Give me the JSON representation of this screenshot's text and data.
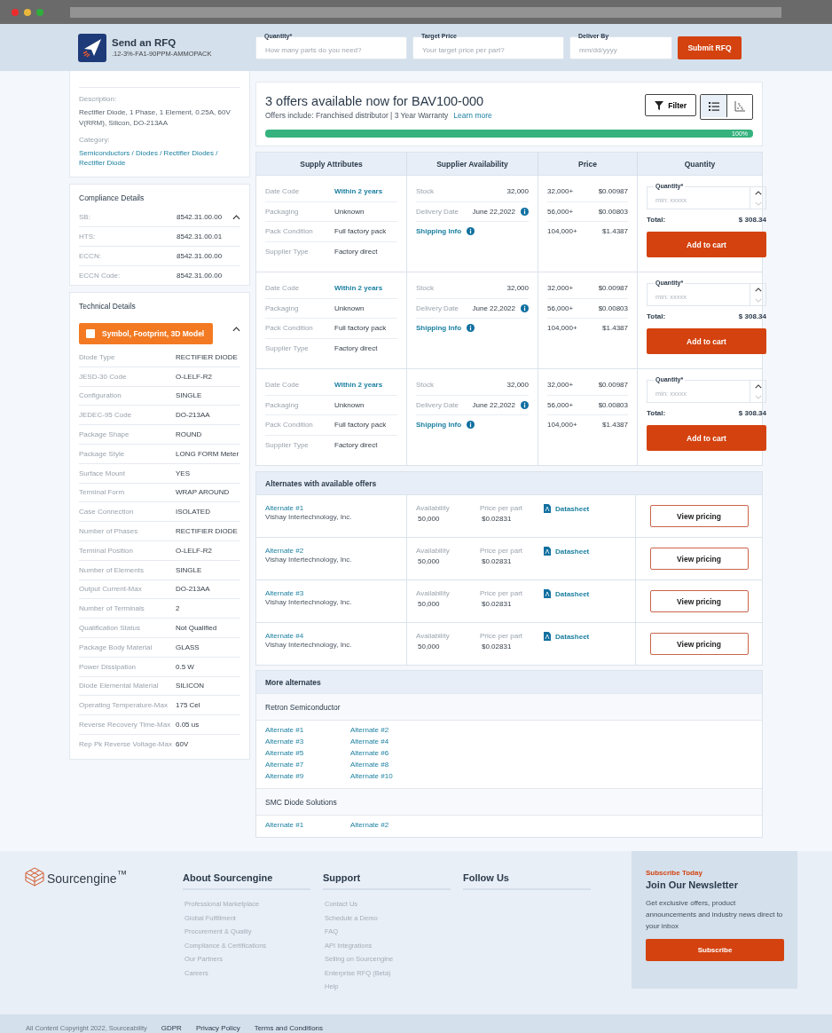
{
  "header": {
    "title": "Send an RFQ",
    "part": ".12-3%-FA1-90PPM-AMMOPACK",
    "fields": [
      {
        "label": "Quantity*",
        "placeholder": "How many parts do you need?"
      },
      {
        "label": "Target Price",
        "placeholder": "Your target price per part?"
      },
      {
        "label": "Deliver By",
        "placeholder": "mm/dd/yyyy"
      }
    ],
    "submit": "Submit RFQ"
  },
  "sidebar": {
    "description_label": "Description:",
    "description": "Rectifier Diode, 1 Phase, 1 Element, 0.25A, 60V V(RRM), Silicon, DO-213AA",
    "category_label": "Category:",
    "category": "Semiconductors / Diodes / Rectifier Diodes / Rectifier Diode",
    "compliance": {
      "title": "Compliance Details",
      "expanded": true,
      "rows": [
        {
          "label": "SB:",
          "value": "8542.31.00.00"
        },
        {
          "label": "HTS:",
          "value": "8542.31.00.01"
        },
        {
          "label": "ECCN:",
          "value": "8542.31.00.00"
        },
        {
          "label": "ECCN Code:",
          "value": "8542.31.00.00"
        }
      ]
    },
    "technical": {
      "title": "Technical Details",
      "expanded": true,
      "model_button": "Symbol, Footprint, 3D Model",
      "rows": [
        {
          "label": "Diode Type",
          "value": "RECTIFIER DIODE"
        },
        {
          "label": "JESD-30 Code",
          "value": "O-LELF-R2"
        },
        {
          "label": "Configuration",
          "value": "SINGLE"
        },
        {
          "label": "JEDEC-95 Code",
          "value": "DO-213AA"
        },
        {
          "label": "Package Shape",
          "value": "ROUND"
        },
        {
          "label": "Package Style",
          "value": "LONG FORM Meter"
        },
        {
          "label": "Surface Mount",
          "value": "YES"
        },
        {
          "label": "Terminal Form",
          "value": "WRAP AROUND"
        },
        {
          "label": "Case Connection",
          "value": "ISOLATED"
        },
        {
          "label": "Number of Phases",
          "value": "RECTIFIER DIODE"
        },
        {
          "label": "Terminal Position",
          "value": "O-LELF-R2"
        },
        {
          "label": "Number of Elements",
          "value": "SINGLE"
        },
        {
          "label": "Output Current-Max",
          "value": "DO-213AA"
        },
        {
          "label": "Number of Terminals",
          "value": "2"
        },
        {
          "label": "Qualification Status",
          "value": "Not Qualified"
        },
        {
          "label": "Package Body Material",
          "value": "GLASS"
        },
        {
          "label": "Power Dissipation",
          "value": "0.5 W"
        },
        {
          "label": "Diode Elemental Material",
          "value": "SILICON"
        },
        {
          "label": "Operating Temperature-Max",
          "value": "175 Cel"
        },
        {
          "label": "Reverse Recovery Time-Max",
          "value": "0.05 us"
        },
        {
          "label": "Rep Pk Reverse Voltage-Max",
          "value": "60V"
        }
      ]
    }
  },
  "offers": {
    "title": "3 offers available now for BAV100-000",
    "subtitle": "Offers include: Franchised distributor | 3 Year Warranty",
    "learn_more": "Learn more",
    "filter": "Filter",
    "views": [
      {
        "kind": "list",
        "selected": true
      },
      {
        "kind": "scatter",
        "selected": false
      }
    ],
    "progress": {
      "level": 1,
      "label": "100%"
    },
    "columns": [
      "Supply Attributes",
      "Supplier Availability",
      "Price",
      "Quantity"
    ],
    "rows": [
      {
        "attributes": [
          {
            "label": "Date Code",
            "value": "Within 2 years",
            "kind": "highlight"
          },
          {
            "label": "Packaging",
            "value": "Unknown",
            "kind": "plain"
          },
          {
            "label": "Pack Condition",
            "value": "Full factory pack",
            "kind": "plain"
          },
          {
            "label": "Supplier Type",
            "value": "Factory direct",
            "kind": "plain"
          }
        ],
        "stock_label": "Stock",
        "stock": "32,000",
        "delivery_label": "Delivery Date",
        "delivery": "June 22,2022",
        "shipping": "Shipping Info",
        "prices": [
          {
            "qty": "32,000+",
            "price": "$0.00987"
          },
          {
            "qty": "56,000+",
            "price": "$0.00803"
          },
          {
            "qty": "104,000+",
            "price": "$1.4387"
          }
        ],
        "quantity_label": "Quantity*",
        "quantity_placeholder": "min: xxxxx",
        "total_label": "Total:",
        "total": "$ 308.34",
        "button": "Add to cart"
      },
      {
        "attributes": [
          {
            "label": "Date Code",
            "value": "Within 2 years",
            "kind": "highlight"
          },
          {
            "label": "Packaging",
            "value": "Unknown",
            "kind": "plain"
          },
          {
            "label": "Pack Condition",
            "value": "Full factory pack",
            "kind": "plain"
          },
          {
            "label": "Supplier Type",
            "value": "Factory direct",
            "kind": "plain"
          }
        ],
        "stock_label": "Stock",
        "stock": "32,000",
        "delivery_label": "Delivery Date",
        "delivery": "June 22,2022",
        "shipping": "Shipping Info",
        "prices": [
          {
            "qty": "32,000+",
            "price": "$0.00987"
          },
          {
            "qty": "56,000+",
            "price": "$0.00803"
          },
          {
            "qty": "104,000+",
            "price": "$1.4387"
          }
        ],
        "quantity_label": "Quantity*",
        "quantity_placeholder": "min: xxxxx",
        "total_label": "Total:",
        "total": "$ 308.34",
        "button": "Add to cart"
      },
      {
        "attributes": [
          {
            "label": "Date Code",
            "value": "Within 2 years",
            "kind": "highlight"
          },
          {
            "label": "Packaging",
            "value": "Unknown",
            "kind": "plain"
          },
          {
            "label": "Pack Condition",
            "value": "Full factory pack",
            "kind": "plain"
          },
          {
            "label": "Supplier Type",
            "value": "Factory direct",
            "kind": "plain"
          }
        ],
        "stock_label": "Stock",
        "stock": "32,000",
        "delivery_label": "Delivery Date",
        "delivery": "June 22,2022",
        "shipping": "Shipping Info",
        "prices": [
          {
            "qty": "32,000+",
            "price": "$0.00987"
          },
          {
            "qty": "56,000+",
            "price": "$0.00803"
          },
          {
            "qty": "104,000+",
            "price": "$1.4387"
          }
        ],
        "quantity_label": "Quantity*",
        "quantity_placeholder": "min: xxxxx",
        "total_label": "Total:",
        "total": "$ 308.34",
        "button": "Add to cart"
      }
    ]
  },
  "alternates": {
    "title": "Alternates with available offers",
    "items": [
      {
        "name": "Alternate #1",
        "maker": "Vishay Intertechnology, Inc.",
        "availability_label": "Availability",
        "availability": "50,000",
        "price_label": "Price per part",
        "price": "$0.02831",
        "datasheet": "Datasheet",
        "button": "View pricing"
      },
      {
        "name": "Alternate #2",
        "maker": "Vishay Intertechnology, Inc.",
        "availability_label": "Availability",
        "availability": "50,000",
        "price_label": "Price per part",
        "price": "$0.02831",
        "datasheet": "Datasheet",
        "button": "View pricing"
      },
      {
        "name": "Alternate #3",
        "maker": "Vishay Intertechnology, Inc.",
        "availability_label": "Availability",
        "availability": "50,000",
        "price_label": "Price per part",
        "price": "$0.02831",
        "datasheet": "Datasheet",
        "button": "View pricing"
      },
      {
        "name": "Alternate #4",
        "maker": "Vishay Intertechnology, Inc.",
        "availability_label": "Availability",
        "availability": "50,000",
        "price_label": "Price per part",
        "price": "$0.02831",
        "datasheet": "Datasheet",
        "button": "View pricing"
      }
    ]
  },
  "more_alternates": {
    "title": "More alternates",
    "groups": [
      {
        "maker": "Retron Semiconductor",
        "links": [
          "Alternate #1",
          "Alternate #2",
          "Alternate #3",
          "Alternate #4",
          "Alternate #5",
          "Alternate #6",
          "Alternate #7",
          "Alternate #8",
          "Alternate #9",
          "Alternate #10"
        ]
      },
      {
        "maker": "SMC Diode Solutions",
        "links": [
          "Alternate #1",
          "Alternate #2"
        ]
      }
    ]
  },
  "footer": {
    "logo": "Sourcengine$^{™}$",
    "columns": [
      {
        "title": "About Sourcengine",
        "links": [
          "Professional Marketplace",
          "Global Fulfillment",
          "Procurement & Quality",
          "Compliance & Certifications",
          "Our Partners",
          "Careers"
        ]
      },
      {
        "title": "Support",
        "links": [
          "Contact Us",
          "Schedule a Demo",
          "FAQ",
          "API Integrations",
          "Selling on Sourcengine",
          "Enterprise RFQ (Beta)",
          "Help"
        ]
      },
      {
        "title": "Follow Us"
      }
    ],
    "newsletter": {
      "eyebrow": "Subscribe Today",
      "title": "Join Our Newsletter",
      "text": "Get exclusive offers, product announcements and industry news direct to your inbox",
      "button": "Subscribe"
    },
    "copyright": "All Content Copyright  2022, Sourceability",
    "legal": [
      "GDPR",
      "Privacy Policy",
      "Terms and Conditions"
    ]
  }
}
